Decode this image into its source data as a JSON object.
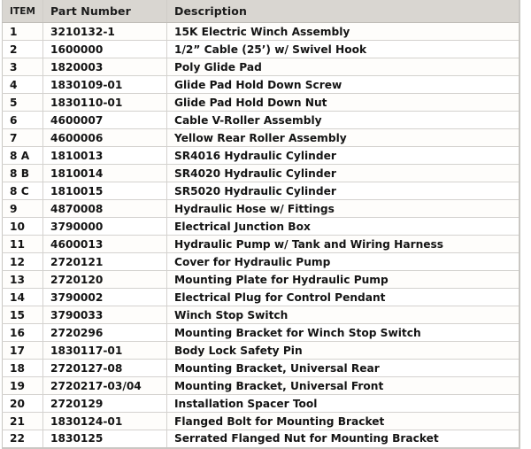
{
  "table": {
    "columns": [
      {
        "key": "item",
        "label": "ITEM"
      },
      {
        "key": "part_number",
        "label": "Part Number"
      },
      {
        "key": "description",
        "label": "Description"
      }
    ],
    "colors": {
      "header_background": "#d9d6d1",
      "header_text": "#1c1c1c",
      "row_background_odd": "#fefdfb",
      "row_background_even": "#ffffff",
      "row_border": "#d4d2cf",
      "outer_border": "#c9c7c3",
      "body_text": "#141414"
    },
    "rows": [
      {
        "item": "1",
        "part_number": "3210132-1",
        "description": "15K Electric Winch Assembly"
      },
      {
        "item": "2",
        "part_number": "1600000",
        "description": "1/2” Cable (25’) w/ Swivel Hook"
      },
      {
        "item": "3",
        "part_number": "1820003",
        "description": "Poly Glide Pad"
      },
      {
        "item": "4",
        "part_number": "1830109-01",
        "description": "Glide Pad Hold Down Screw"
      },
      {
        "item": "5",
        "part_number": "1830110-01",
        "description": "Glide Pad Hold Down Nut"
      },
      {
        "item": "6",
        "part_number": "4600007",
        "description": "Cable V-Roller Assembly"
      },
      {
        "item": "7",
        "part_number": "4600006",
        "description": "Yellow Rear Roller Assembly"
      },
      {
        "item": "8 A",
        "part_number": "1810013",
        "description": "SR4016 Hydraulic Cylinder"
      },
      {
        "item": "8 B",
        "part_number": "1810014",
        "description": "SR4020 Hydraulic Cylinder"
      },
      {
        "item": "8 C",
        "part_number": "1810015",
        "description": "SR5020 Hydraulic Cylinder"
      },
      {
        "item": "9",
        "part_number": "4870008",
        "description": "Hydraulic Hose w/ Fittings"
      },
      {
        "item": "10",
        "part_number": "3790000",
        "description": "Electrical Junction Box"
      },
      {
        "item": "11",
        "part_number": "4600013",
        "description": "Hydraulic Pump w/ Tank and Wiring Harness"
      },
      {
        "item": "12",
        "part_number": "2720121",
        "description": "Cover for Hydraulic Pump"
      },
      {
        "item": "13",
        "part_number": "2720120",
        "description": "Mounting Plate for Hydraulic Pump"
      },
      {
        "item": "14",
        "part_number": "3790002",
        "description": "Electrical Plug for Control Pendant"
      },
      {
        "item": "15",
        "part_number": "3790033",
        "description": "Winch Stop Switch"
      },
      {
        "item": "16",
        "part_number": "2720296",
        "description": "Mounting Bracket for Winch Stop Switch"
      },
      {
        "item": "17",
        "part_number": "1830117-01",
        "description": "Body Lock Safety Pin"
      },
      {
        "item": "18",
        "part_number": "2720127-08",
        "description": "Mounting Bracket, Universal Rear"
      },
      {
        "item": "19",
        "part_number": "2720217-03/04",
        "description": "Mounting Bracket, Universal Front"
      },
      {
        "item": "20",
        "part_number": "2720129",
        "description": "Installation Spacer Tool"
      },
      {
        "item": "21",
        "part_number": "1830124-01",
        "description": "Flanged Bolt for Mounting Bracket"
      },
      {
        "item": "22",
        "part_number": "1830125",
        "description": "Serrated Flanged Nut for Mounting Bracket"
      }
    ]
  }
}
